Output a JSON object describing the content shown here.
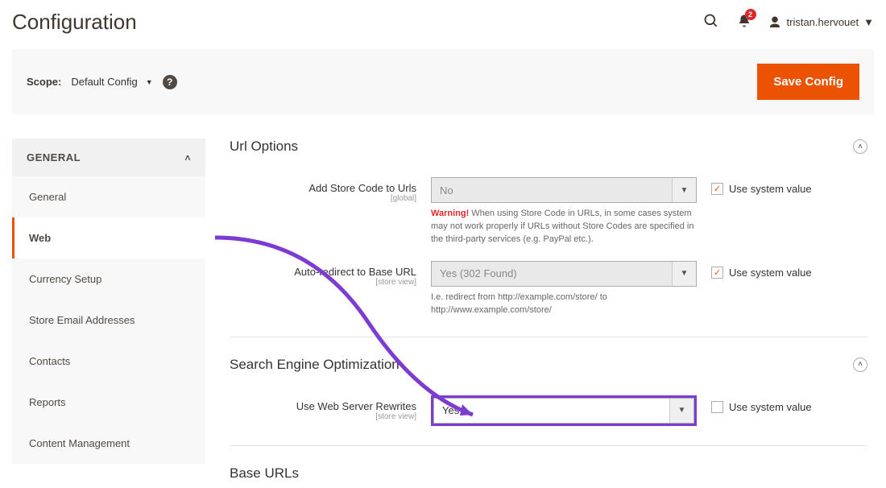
{
  "header": {
    "title": "Configuration",
    "notification_count": "2",
    "user_name": "tristan.hervouet"
  },
  "scope": {
    "label": "Scope:",
    "value": "Default Config",
    "save_label": "Save Config"
  },
  "sidebar": {
    "section": "GENERAL",
    "items": [
      {
        "label": "General"
      },
      {
        "label": "Web"
      },
      {
        "label": "Currency Setup"
      },
      {
        "label": "Store Email Addresses"
      },
      {
        "label": "Contacts"
      },
      {
        "label": "Reports"
      },
      {
        "label": "Content Management"
      }
    ]
  },
  "sections": {
    "url_options": {
      "title": "Url Options",
      "fields": {
        "store_code": {
          "label": "Add Store Code to Urls",
          "scope": "[global]",
          "value": "No",
          "warning_prefix": "Warning!",
          "warning_text": " When using Store Code in URLs, in some cases system may not work properly if URLs without Store Codes are specified in the third-party services (e.g. PayPal etc.).",
          "use_system": "Use system value",
          "checked": true
        },
        "auto_redirect": {
          "label": "Auto-redirect to Base URL",
          "scope": "[store view]",
          "value": "Yes (302 Found)",
          "note": "I.e. redirect from http://example.com/store/ to http://www.example.com/store/",
          "use_system": "Use system value",
          "checked": true
        }
      }
    },
    "seo": {
      "title": "Search Engine Optimization",
      "fields": {
        "rewrites": {
          "label": "Use Web Server Rewrites",
          "scope": "[store view]",
          "value": "Yes",
          "use_system": "Use system value",
          "checked": false
        }
      }
    },
    "base_urls": {
      "title": "Base URLs"
    }
  }
}
